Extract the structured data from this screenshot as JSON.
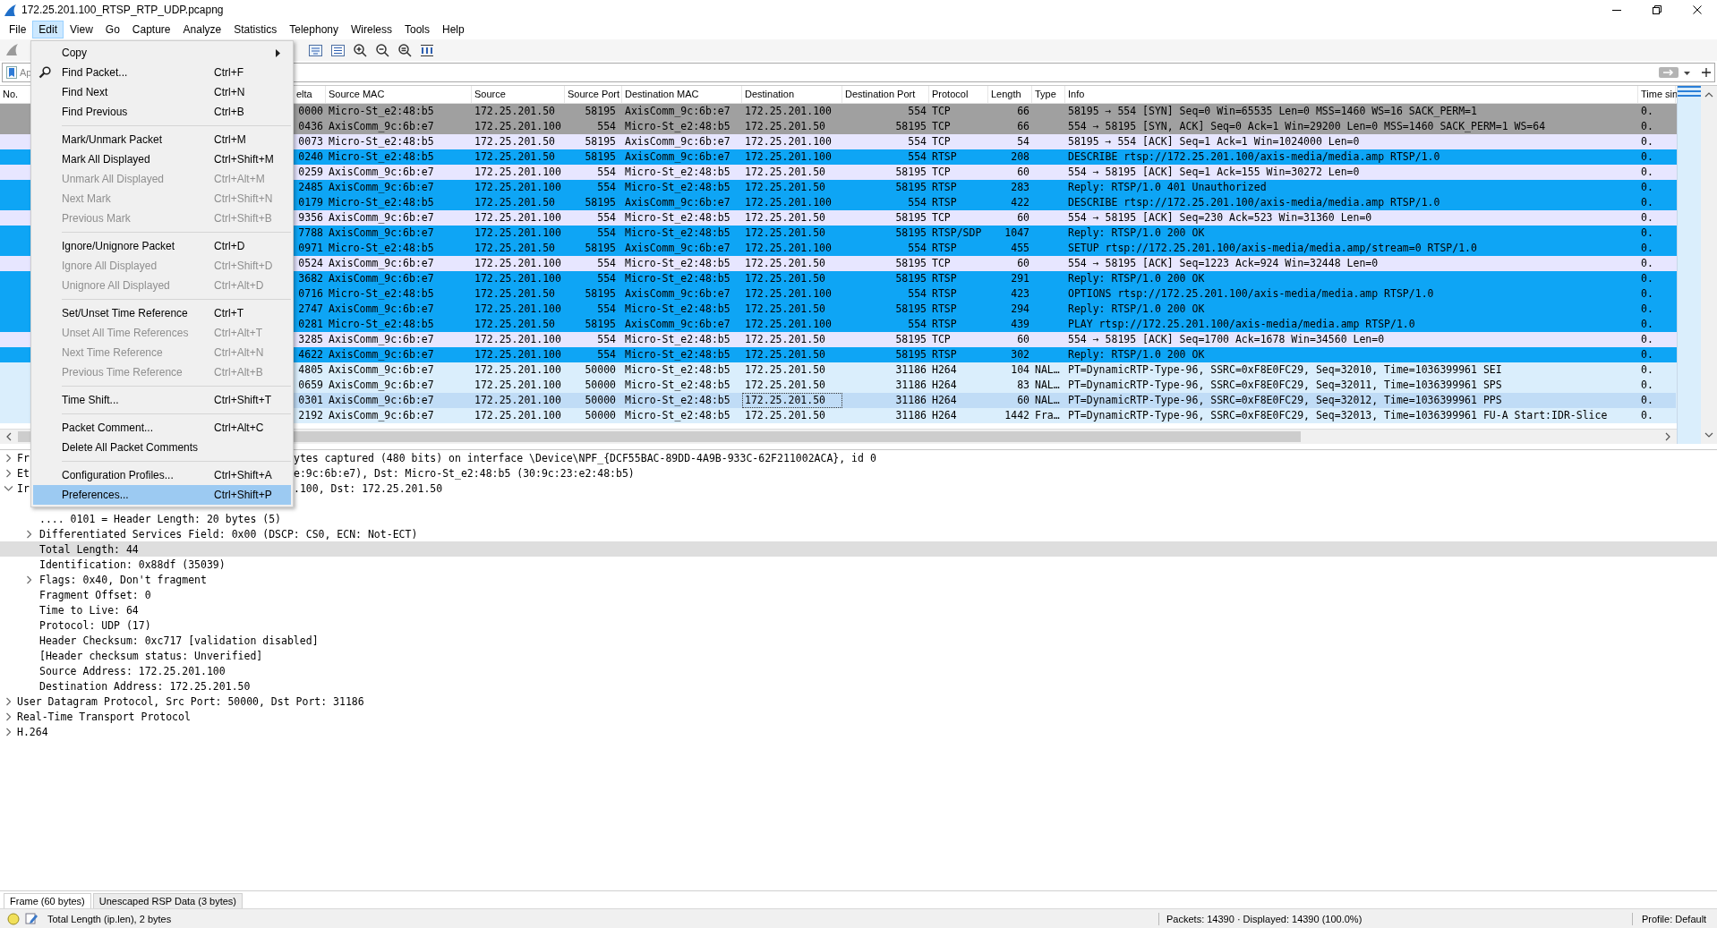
{
  "window": {
    "title": "172.25.201.100_RTSP_RTP_UDP.pcapng"
  },
  "menu_bar": [
    {
      "label": "File",
      "selected": false
    },
    {
      "label": "Edit",
      "selected": true
    },
    {
      "label": "View",
      "selected": false
    },
    {
      "label": "Go",
      "selected": false
    },
    {
      "label": "Capture",
      "selected": false
    },
    {
      "label": "Analyze",
      "selected": false
    },
    {
      "label": "Statistics",
      "selected": false
    },
    {
      "label": "Telephony",
      "selected": false
    },
    {
      "label": "Wireless",
      "selected": false
    },
    {
      "label": "Tools",
      "selected": false
    },
    {
      "label": "Help",
      "selected": false
    }
  ],
  "edit_menu": {
    "groups": [
      {
        "items": [
          {
            "kind": "submenu",
            "label": "Copy",
            "disabled": false,
            "selected": false
          },
          {
            "kind": "find",
            "label": "Find Packet...",
            "shortcut": "Ctrl+F",
            "disabled": false,
            "selected": false
          },
          {
            "kind": "command",
            "label": "Find Next",
            "shortcut": "Ctrl+N",
            "disabled": false,
            "selected": false
          },
          {
            "kind": "command",
            "label": "Find Previous",
            "shortcut": "Ctrl+B",
            "disabled": false,
            "selected": false
          }
        ]
      },
      {
        "items": [
          {
            "kind": "command",
            "label": "Mark/Unmark Packet",
            "shortcut": "Ctrl+M",
            "disabled": false,
            "selected": false
          },
          {
            "kind": "command",
            "label": "Mark All Displayed",
            "shortcut": "Ctrl+Shift+M",
            "disabled": false,
            "selected": false
          },
          {
            "kind": "command",
            "label": "Unmark All Displayed",
            "shortcut": "Ctrl+Alt+M",
            "disabled": true,
            "selected": false
          },
          {
            "kind": "command",
            "label": "Next Mark",
            "shortcut": "Ctrl+Shift+N",
            "disabled": true,
            "selected": false
          },
          {
            "kind": "command",
            "label": "Previous Mark",
            "shortcut": "Ctrl+Shift+B",
            "disabled": true,
            "selected": false
          }
        ]
      },
      {
        "items": [
          {
            "kind": "command",
            "label": "Ignore/Unignore Packet",
            "shortcut": "Ctrl+D",
            "disabled": false,
            "selected": false
          },
          {
            "kind": "command",
            "label": "Ignore All Displayed",
            "shortcut": "Ctrl+Shift+D",
            "disabled": true,
            "selected": false
          },
          {
            "kind": "command",
            "label": "Unignore All Displayed",
            "shortcut": "Ctrl+Alt+D",
            "disabled": true,
            "selected": false
          }
        ]
      },
      {
        "items": [
          {
            "kind": "command",
            "label": "Set/Unset Time Reference",
            "shortcut": "Ctrl+T",
            "disabled": false,
            "selected": false
          },
          {
            "kind": "command",
            "label": "Unset All Time References",
            "shortcut": "Ctrl+Alt+T",
            "disabled": true,
            "selected": false
          },
          {
            "kind": "command",
            "label": "Next Time Reference",
            "shortcut": "Ctrl+Alt+N",
            "disabled": true,
            "selected": false
          },
          {
            "kind": "command",
            "label": "Previous Time Reference",
            "shortcut": "Ctrl+Alt+B",
            "disabled": true,
            "selected": false
          }
        ]
      },
      {
        "items": [
          {
            "kind": "command",
            "label": "Time Shift...",
            "shortcut": "Ctrl+Shift+T",
            "disabled": false,
            "selected": false
          }
        ]
      },
      {
        "items": [
          {
            "kind": "command",
            "label": "Packet Comment...",
            "shortcut": "Ctrl+Alt+C",
            "disabled": false,
            "selected": false
          },
          {
            "kind": "command",
            "label": "Delete All Packet Comments",
            "disabled": false,
            "selected": false
          }
        ]
      },
      {
        "items": [
          {
            "kind": "command",
            "label": "Configuration Profiles...",
            "shortcut": "Ctrl+Shift+A",
            "disabled": false,
            "selected": false
          },
          {
            "kind": "command",
            "label": "Preferences...",
            "shortcut": "Ctrl+Shift+P",
            "disabled": false,
            "selected": true
          }
        ]
      }
    ]
  },
  "filter_bar": {
    "placeholder": "Ap"
  },
  "packet_list": {
    "columns": [
      {
        "label": "No."
      },
      {
        "label": "elta"
      },
      {
        "label": "Source MAC"
      },
      {
        "label": "Source"
      },
      {
        "label": "Source Port"
      },
      {
        "label": "Destination MAC"
      },
      {
        "label": "Destination"
      },
      {
        "label": "Destination Port"
      },
      {
        "label": "Protocol"
      },
      {
        "label": "Length"
      },
      {
        "label": "Type"
      },
      {
        "label": "Info"
      },
      {
        "label": "Time sin"
      }
    ],
    "rows": [
      {
        "delta": "0000",
        "source_mac": "Micro-St_e2:48:b5",
        "source": "172.25.201.50",
        "source_port": "58195",
        "destination_mac": "AxisComm_9c:6b:e7",
        "destination": "172.25.201.100",
        "destination_port": "554",
        "protocol": "TCP",
        "length": "66",
        "info": "58195 → 554 [SYN] Seq=0 Win=65535 Len=0 MSS=1460 WS=16 SACK_PERM=1",
        "time_since": "0.",
        "color": "#a0a0a0",
        "selected": false
      },
      {
        "delta": "0436",
        "source_mac": "AxisComm_9c:6b:e7",
        "source": "172.25.201.100",
        "source_port": "554",
        "destination_mac": "Micro-St_e2:48:b5",
        "destination": "172.25.201.50",
        "destination_port": "58195",
        "protocol": "TCP",
        "length": "66",
        "info": "554 → 58195 [SYN, ACK] Seq=0 Ack=1 Win=29200 Len=0 MSS=1460 SACK_PERM=1 WS=64",
        "time_since": "0.",
        "color": "#a0a0a0",
        "selected": false
      },
      {
        "delta": "0073",
        "source_mac": "Micro-St_e2:48:b5",
        "source": "172.25.201.50",
        "source_port": "58195",
        "destination_mac": "AxisComm_9c:6b:e7",
        "destination": "172.25.201.100",
        "destination_port": "554",
        "protocol": "TCP",
        "length": "54",
        "info": "58195 → 554 [ACK] Seq=1 Ack=1 Win=1024000 Len=0",
        "time_since": "0.",
        "color": "#e7e6ff",
        "selected": false
      },
      {
        "delta": "0240",
        "source_mac": "Micro-St_e2:48:b5",
        "source": "172.25.201.50",
        "source_port": "58195",
        "destination_mac": "AxisComm_9c:6b:e7",
        "destination": "172.25.201.100",
        "destination_port": "554",
        "protocol": "RTSP",
        "length": "208",
        "info": "DESCRIBE rtsp://172.25.201.100/axis-media/media.amp RTSP/1.0",
        "time_since": "0.",
        "color": "#0ea5f5",
        "selected": false
      },
      {
        "delta": "0259",
        "source_mac": "AxisComm_9c:6b:e7",
        "source": "172.25.201.100",
        "source_port": "554",
        "destination_mac": "Micro-St_e2:48:b5",
        "destination": "172.25.201.50",
        "destination_port": "58195",
        "protocol": "TCP",
        "length": "60",
        "info": "554 → 58195 [ACK] Seq=1 Ack=155 Win=30272 Len=0",
        "time_since": "0.",
        "color": "#e7e6ff",
        "selected": false
      },
      {
        "delta": "2485",
        "source_mac": "AxisComm_9c:6b:e7",
        "source": "172.25.201.100",
        "source_port": "554",
        "destination_mac": "Micro-St_e2:48:b5",
        "destination": "172.25.201.50",
        "destination_port": "58195",
        "protocol": "RTSP",
        "length": "283",
        "info": "Reply: RTSP/1.0 401 Unauthorized",
        "time_since": "0.",
        "color": "#0ea5f5",
        "selected": false
      },
      {
        "delta": "0179",
        "source_mac": "Micro-St_e2:48:b5",
        "source": "172.25.201.50",
        "source_port": "58195",
        "destination_mac": "AxisComm_9c:6b:e7",
        "destination": "172.25.201.100",
        "destination_port": "554",
        "protocol": "RTSP",
        "length": "422",
        "info": "DESCRIBE rtsp://172.25.201.100/axis-media/media.amp RTSP/1.0",
        "time_since": "0.",
        "color": "#0ea5f5",
        "selected": false
      },
      {
        "delta": "9356",
        "source_mac": "AxisComm_9c:6b:e7",
        "source": "172.25.201.100",
        "source_port": "554",
        "destination_mac": "Micro-St_e2:48:b5",
        "destination": "172.25.201.50",
        "destination_port": "58195",
        "protocol": "TCP",
        "length": "60",
        "info": "554 → 58195 [ACK] Seq=230 Ack=523 Win=31360 Len=0",
        "time_since": "0.",
        "color": "#e7e6ff",
        "selected": false
      },
      {
        "delta": "7788",
        "source_mac": "AxisComm_9c:6b:e7",
        "source": "172.25.201.100",
        "source_port": "554",
        "destination_mac": "Micro-St_e2:48:b5",
        "destination": "172.25.201.50",
        "destination_port": "58195",
        "protocol": "RTSP/SDP",
        "length": "1047",
        "info": "Reply: RTSP/1.0 200 OK",
        "time_since": "0.",
        "color": "#0ea5f5",
        "selected": false
      },
      {
        "delta": "0971",
        "source_mac": "Micro-St_e2:48:b5",
        "source": "172.25.201.50",
        "source_port": "58195",
        "destination_mac": "AxisComm_9c:6b:e7",
        "destination": "172.25.201.100",
        "destination_port": "554",
        "protocol": "RTSP",
        "length": "455",
        "info": "SETUP rtsp://172.25.201.100/axis-media/media.amp/stream=0 RTSP/1.0",
        "time_since": "0.",
        "color": "#0ea5f5",
        "selected": false
      },
      {
        "delta": "0524",
        "source_mac": "AxisComm_9c:6b:e7",
        "source": "172.25.201.100",
        "source_port": "554",
        "destination_mac": "Micro-St_e2:48:b5",
        "destination": "172.25.201.50",
        "destination_port": "58195",
        "protocol": "TCP",
        "length": "60",
        "info": "554 → 58195 [ACK] Seq=1223 Ack=924 Win=32448 Len=0",
        "time_since": "0.",
        "color": "#e7e6ff",
        "selected": false
      },
      {
        "delta": "3682",
        "source_mac": "AxisComm_9c:6b:e7",
        "source": "172.25.201.100",
        "source_port": "554",
        "destination_mac": "Micro-St_e2:48:b5",
        "destination": "172.25.201.50",
        "destination_port": "58195",
        "protocol": "RTSP",
        "length": "291",
        "info": "Reply: RTSP/1.0 200 OK",
        "time_since": "0.",
        "color": "#0ea5f5",
        "selected": false
      },
      {
        "delta": "0716",
        "source_mac": "Micro-St_e2:48:b5",
        "source": "172.25.201.50",
        "source_port": "58195",
        "destination_mac": "AxisComm_9c:6b:e7",
        "destination": "172.25.201.100",
        "destination_port": "554",
        "protocol": "RTSP",
        "length": "423",
        "info": "OPTIONS rtsp://172.25.201.100/axis-media/media.amp RTSP/1.0",
        "time_since": "0.",
        "color": "#0ea5f5",
        "selected": false
      },
      {
        "delta": "2747",
        "source_mac": "AxisComm_9c:6b:e7",
        "source": "172.25.201.100",
        "source_port": "554",
        "destination_mac": "Micro-St_e2:48:b5",
        "destination": "172.25.201.50",
        "destination_port": "58195",
        "protocol": "RTSP",
        "length": "294",
        "info": "Reply: RTSP/1.0 200 OK",
        "time_since": "0.",
        "color": "#0ea5f5",
        "selected": false
      },
      {
        "delta": "0281",
        "source_mac": "Micro-St_e2:48:b5",
        "source": "172.25.201.50",
        "source_port": "58195",
        "destination_mac": "AxisComm_9c:6b:e7",
        "destination": "172.25.201.100",
        "destination_port": "554",
        "protocol": "RTSP",
        "length": "439",
        "info": "PLAY rtsp://172.25.201.100/axis-media/media.amp RTSP/1.0",
        "time_since": "0.",
        "color": "#0ea5f5",
        "selected": false
      },
      {
        "delta": "3285",
        "source_mac": "AxisComm_9c:6b:e7",
        "source": "172.25.201.100",
        "source_port": "554",
        "destination_mac": "Micro-St_e2:48:b5",
        "destination": "172.25.201.50",
        "destination_port": "58195",
        "protocol": "TCP",
        "length": "60",
        "info": "554 → 58195 [ACK] Seq=1700 Ack=1678 Win=34560 Len=0",
        "time_since": "0.",
        "color": "#e7e6ff",
        "selected": false
      },
      {
        "delta": "4622",
        "source_mac": "AxisComm_9c:6b:e7",
        "source": "172.25.201.100",
        "source_port": "554",
        "destination_mac": "Micro-St_e2:48:b5",
        "destination": "172.25.201.50",
        "destination_port": "58195",
        "protocol": "RTSP",
        "length": "302",
        "info": "Reply: RTSP/1.0 200 OK",
        "time_since": "0.",
        "color": "#0ea5f5",
        "selected": false
      },
      {
        "delta": "4805",
        "source_mac": "AxisComm_9c:6b:e7",
        "source": "172.25.201.100",
        "source_port": "50000",
        "destination_mac": "Micro-St_e2:48:b5",
        "destination": "172.25.201.50",
        "destination_port": "31186",
        "protocol": "H264",
        "length": "104",
        "type": "NAL…",
        "info": "PT=DynamicRTP-Type-96, SSRC=0xF8E0FC29, Seq=32010, Time=1036399961 SEI",
        "time_since": "0.",
        "color": "#daeefc",
        "selected": false
      },
      {
        "delta": "0659",
        "source_mac": "AxisComm_9c:6b:e7",
        "source": "172.25.201.100",
        "source_port": "50000",
        "destination_mac": "Micro-St_e2:48:b5",
        "destination": "172.25.201.50",
        "destination_port": "31186",
        "protocol": "H264",
        "length": "83",
        "type": "NAL…",
        "info": "PT=DynamicRTP-Type-96, SSRC=0xF8E0FC29, Seq=32011, Time=1036399961 SPS",
        "time_since": "0.",
        "color": "#daeefc",
        "selected": false
      },
      {
        "delta": "0301",
        "source_mac": "AxisComm_9c:6b:e7",
        "source": "172.25.201.100",
        "source_port": "50000",
        "destination_mac": "Micro-St_e2:48:b5",
        "destination": "172.25.201.50",
        "destination_port": "31186",
        "protocol": "H264",
        "length": "60",
        "type": "NAL…",
        "info": "PT=DynamicRTP-Type-96, SSRC=0xF8E0FC29, Seq=32012, Time=1036399961 PPS",
        "time_since": "0.",
        "color": "#daeefc",
        "selected": true
      },
      {
        "delta": "2192",
        "source_mac": "AxisComm_9c:6b:e7",
        "source": "172.25.201.100",
        "source_port": "50000",
        "destination_mac": "Micro-St_e2:48:b5",
        "destination": "172.25.201.50",
        "destination_port": "31186",
        "protocol": "H264",
        "length": "1442",
        "type": "Fra…",
        "info": "PT=DynamicRTP-Type-96, SSRC=0xF8E0FC29, Seq=32013, Time=1036399961 FU-A Start:IDR-Slice",
        "time_since": "0.",
        "color": "#daeefc",
        "selected": false
      }
    ]
  },
  "details": {
    "items": [
      {
        "kind": "node",
        "lead": "Fr",
        "text": "ytes captured (480 bits) on interface \\Device\\NPF_{DCF55BAC-89DD-4A9B-933C-62F211002ACA}, id 0",
        "expanded": false,
        "selected": false
      },
      {
        "kind": "node",
        "lead": "Et",
        "text": "e:9c:6b:e7), Dst: Micro-St_e2:48:b5 (30:9c:23:e2:48:b5)",
        "expanded": false,
        "selected": false
      },
      {
        "kind": "node",
        "lead": "Ir",
        "text": ".100, Dst: 172.25.201.50",
        "expanded": true,
        "selected": false,
        "children": [
          {
            "kind": "leaf",
            "text": ".... 0101 = Header Length: 20 bytes (5)",
            "selected": false
          },
          {
            "kind": "node",
            "text": "Differentiated Services Field: 0x00 (DSCP: CS0, ECN: Not-ECT)",
            "expanded": false,
            "selected": false
          },
          {
            "kind": "leaf",
            "text": "Total Length: 44",
            "selected": true
          },
          {
            "kind": "leaf",
            "text": "Identification: 0x88df (35039)",
            "selected": false
          },
          {
            "kind": "node",
            "text": "Flags: 0x40, Don't fragment",
            "expanded": false,
            "selected": false
          },
          {
            "kind": "leaf",
            "text": "Fragment Offset: 0",
            "selected": false
          },
          {
            "kind": "leaf",
            "text": "Time to Live: 64",
            "selected": false
          },
          {
            "kind": "leaf",
            "text": "Protocol: UDP (17)",
            "selected": false
          },
          {
            "kind": "leaf",
            "text": "Header Checksum: 0xc717 [validation disabled]",
            "selected": false
          },
          {
            "kind": "leaf",
            "text": "[Header checksum status: Unverified]",
            "selected": false
          },
          {
            "kind": "leaf",
            "text": "Source Address: 172.25.201.100",
            "selected": false
          },
          {
            "kind": "leaf",
            "text": "Destination Address: 172.25.201.50",
            "selected": false
          }
        ]
      },
      {
        "kind": "node",
        "text": "User Datagram Protocol, Src Port: 50000, Dst Port: 31186",
        "expanded": false,
        "selected": false
      },
      {
        "kind": "node",
        "text": "Real-Time Transport Protocol",
        "expanded": false,
        "selected": false
      },
      {
        "kind": "node",
        "text": "H.264",
        "expanded": false,
        "selected": false
      }
    ]
  },
  "bytes_tabs": [
    {
      "label": "Frame (60 bytes)",
      "selected": true
    },
    {
      "label": "Unescaped RSP Data (3 bytes)",
      "selected": false
    }
  ],
  "status_bar": {
    "field_info": "Total Length (ip.len), 2 bytes",
    "packets": "Packets: 14390 · Displayed: 14390 (100.0%)",
    "profile": "Profile: Default"
  }
}
